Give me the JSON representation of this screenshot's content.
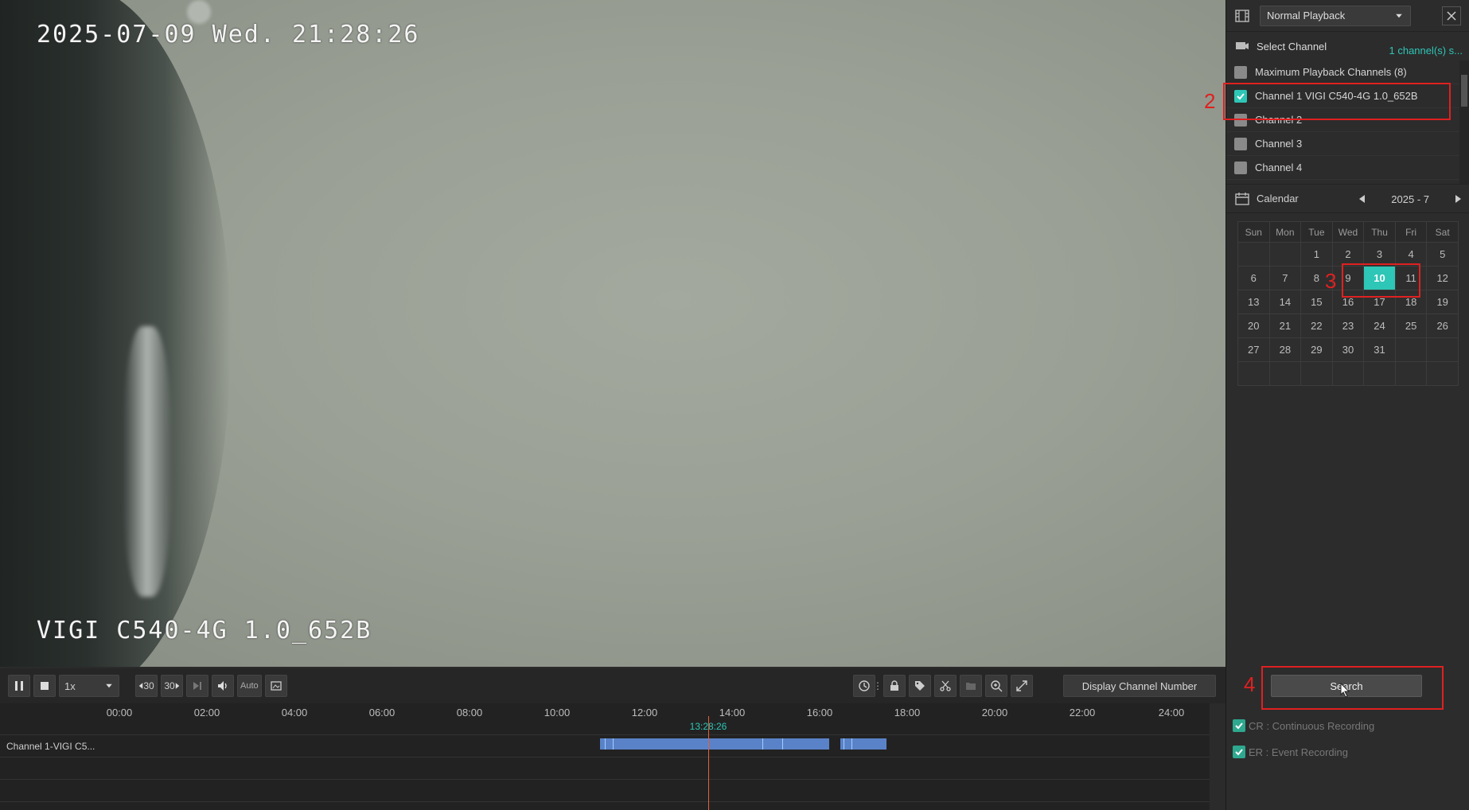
{
  "video": {
    "osd_datetime": "2025-07-09 Wed. 21:28:26",
    "osd_camera": "VIGI C540-4G 1.0_652B"
  },
  "controls": {
    "speed": "1x",
    "rewind_label": "30",
    "forward_label": "30",
    "auto_label": "Auto",
    "display_channel_label": "Display Channel Number"
  },
  "timeline": {
    "ticks": [
      "00:00",
      "02:00",
      "04:00",
      "06:00",
      "08:00",
      "10:00",
      "12:00",
      "14:00",
      "16:00",
      "18:00",
      "20:00",
      "22:00",
      "24:00"
    ],
    "cursor_time": "13:28:26",
    "row_label": "Channel 1-VIGI C5..."
  },
  "panel": {
    "mode": "Normal Playback",
    "select_channel_label": "Select Channel",
    "channel_count": "1 channel(s) s...",
    "channels": [
      {
        "label": "Maximum Playback Channels (8)",
        "checked": false
      },
      {
        "label": "Channel 1 VIGI C540-4G 1.0_652B",
        "checked": true
      },
      {
        "label": "Channel 2",
        "checked": false
      },
      {
        "label": "Channel 3",
        "checked": false
      },
      {
        "label": "Channel 4",
        "checked": false
      }
    ],
    "calendar_label": "Calendar",
    "month": "2025 - 7",
    "weekdays": [
      "Sun",
      "Mon",
      "Tue",
      "Wed",
      "Thu",
      "Fri",
      "Sat"
    ],
    "weeks": [
      [
        "",
        "",
        "1",
        "2",
        "3",
        "4",
        "5"
      ],
      [
        "6",
        "7",
        "8",
        "9",
        "10",
        "11",
        "12"
      ],
      [
        "13",
        "14",
        "15",
        "16",
        "17",
        "18",
        "19"
      ],
      [
        "20",
        "21",
        "22",
        "23",
        "24",
        "25",
        "26"
      ],
      [
        "27",
        "28",
        "29",
        "30",
        "31",
        "",
        ""
      ],
      [
        "",
        "",
        "",
        "",
        "",
        "",
        ""
      ]
    ],
    "selected_day": "10",
    "search_label": "Search",
    "legend_cr": "CR : Continuous Recording",
    "legend_er": "ER : Event Recording"
  },
  "annotations": [
    "2",
    "3",
    "4"
  ],
  "colors": {
    "accent": "#2ec6b6",
    "recording": "#5a82c8",
    "playhead": "#e2623c",
    "annotation": "#e02020"
  }
}
